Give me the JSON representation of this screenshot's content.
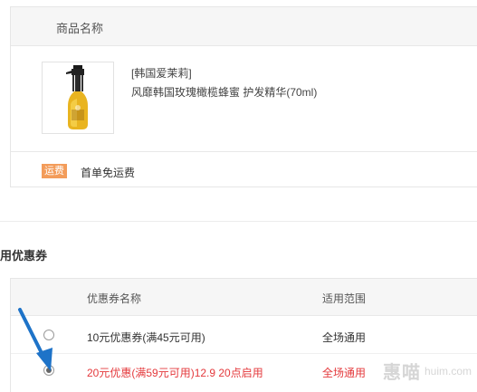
{
  "product_section": {
    "column_title": "商品名称",
    "product": {
      "brand": "[韩国爱茉莉]",
      "name": "风靡韩国玫瑰橄榄蜂蜜 护发精华(70ml)",
      "image_icon": "hair-oil-bottle-icon"
    },
    "shipping": {
      "badge": "运费",
      "text": "首单免运费"
    }
  },
  "coupon_section": {
    "title": "用优惠券",
    "columns": {
      "name": "优惠券名称",
      "scope": "适用范围"
    },
    "coupons": [
      {
        "name": "10元优惠券(满45元可用)",
        "scope": "全场通用",
        "selected": false
      },
      {
        "name": "20元优惠(满59元可用)12.9 20点启用",
        "scope": "全场通用",
        "selected": true
      }
    ]
  },
  "watermark": {
    "cn": "惠喵",
    "en": "huim.com"
  },
  "colors": {
    "accent_red": "#e4393c",
    "badge_orange": "#f39c5a",
    "arrow_blue": "#1e73c8"
  }
}
